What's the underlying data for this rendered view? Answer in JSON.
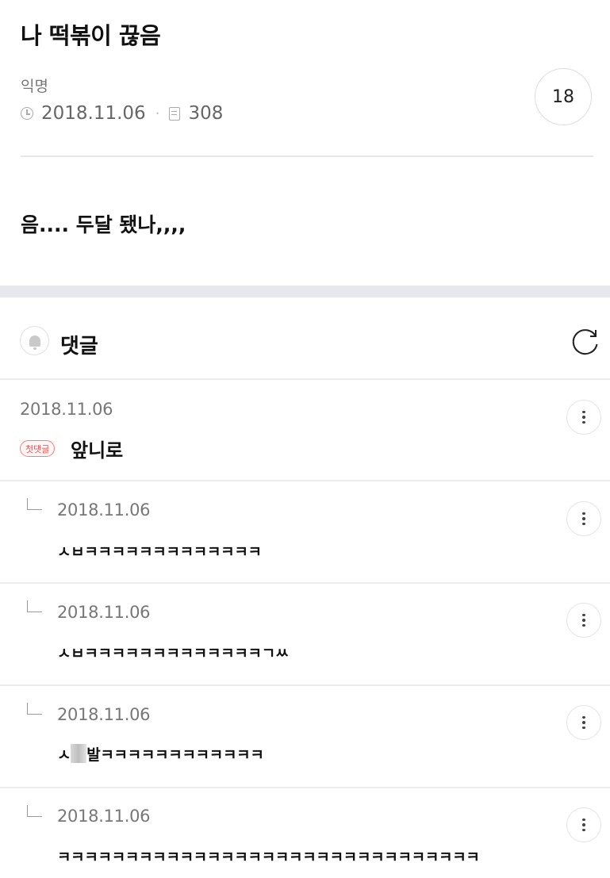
{
  "post": {
    "title": "나 떡볶이 끊음",
    "author": "익명",
    "date": "2018.11.06",
    "views": "308",
    "comment_count": "18",
    "body": "음.... 두달 됐나,,,,"
  },
  "comments_header": {
    "label": "댓글",
    "icons": {
      "bell": "bell-icon",
      "refresh": "refresh-icon",
      "more": "more-vertical-icon"
    }
  },
  "comments": [
    {
      "date": "2018.11.06",
      "badge": "첫댓글",
      "text": "앞니로"
    },
    {
      "date": "2018.11.06",
      "text": "ㅅㅂㅋㅋㅋㅋㅋㅋㅋㅋㅋㅋㅋㅋㅋ"
    },
    {
      "date": "2018.11.06",
      "text": "ㅅㅂㅋㅋㅋㅋㅋㅋㅋㅋㅋㅋㅋㅋㅋㄱㅆ"
    },
    {
      "date": "2018.11.06",
      "text_prefix": "ㅅ",
      "text": "발ㅋㅋㅋㅋㅋㅋㅋㅋㅋㅋㅋㅋ"
    },
    {
      "date": "2018.11.06",
      "text": "ㅋㅋㅋㅋㅋㅋㅋㅋㅋㅋㅋㅋㅋㅋㅋㅋㅋㅋㅋㅋㅋㅋㅋㅋㅋㅋㅋㅋㅋㅋㅋ"
    }
  ]
}
